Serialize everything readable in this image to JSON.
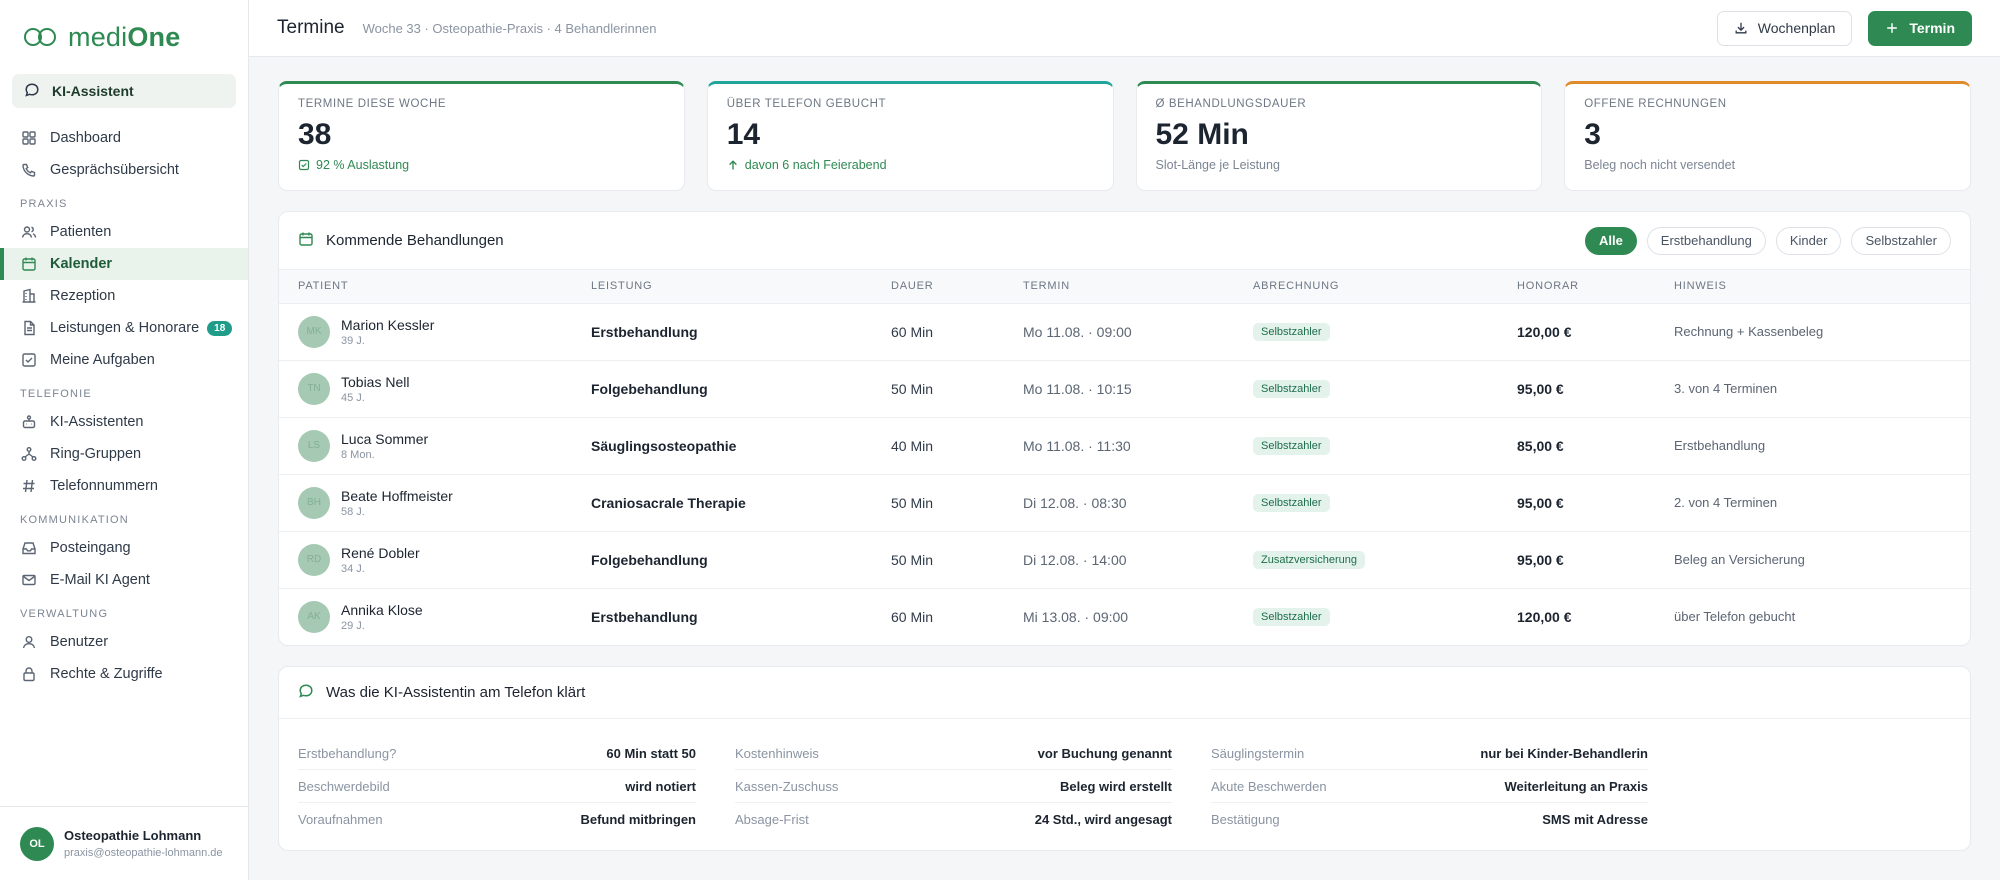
{
  "app": {
    "logo_light": "medi",
    "logo_bold": "One",
    "ki_button": "KI-Assistent"
  },
  "sidebar": {
    "top_items": [
      {
        "label": "Dashboard",
        "icon": "grid-icon"
      },
      {
        "label": "Gesprächsübersicht",
        "icon": "phone-icon"
      }
    ],
    "sections": [
      {
        "title": "PRAXIS",
        "items": [
          {
            "label": "Patienten",
            "icon": "users-icon"
          },
          {
            "label": "Kalender",
            "icon": "calendar-icon",
            "active": true
          },
          {
            "label": "Rezeption",
            "icon": "building-icon"
          },
          {
            "label": "Leistungen & Honorare",
            "icon": "document-icon",
            "badge": "18"
          },
          {
            "label": "Meine Aufgaben",
            "icon": "checkbox-icon"
          }
        ]
      },
      {
        "title": "TELEFONIE",
        "items": [
          {
            "label": "KI-Assistenten",
            "icon": "robot-icon"
          },
          {
            "label": "Ring-Gruppen",
            "icon": "network-icon"
          },
          {
            "label": "Telefonnummern",
            "icon": "hash-icon"
          }
        ]
      },
      {
        "title": "KOMMUNIKATION",
        "items": [
          {
            "label": "Posteingang",
            "icon": "inbox-icon"
          },
          {
            "label": "E-Mail KI Agent",
            "icon": "mail-icon"
          }
        ]
      },
      {
        "title": "VERWALTUNG",
        "items": [
          {
            "label": "Benutzer",
            "icon": "user-icon"
          },
          {
            "label": "Rechte & Zugriffe",
            "icon": "lock-icon"
          }
        ]
      }
    ],
    "user": {
      "initials": "OL",
      "name": "Osteopathie Lohmann",
      "email": "praxis@osteopathie-lohmann.de"
    }
  },
  "header": {
    "title": "Termine",
    "subtitle": "Woche 33 · Osteopathie-Praxis · 4 Behandlerinnen",
    "week_button": "Wochenplan",
    "add_button": "Termin"
  },
  "stats": [
    {
      "label": "TERMINE DIESE WOCHE",
      "value": "38",
      "foot": "92 % Auslastung",
      "color": "#2e8a52"
    },
    {
      "label": "ÜBER TELEFON GEBUCHT",
      "value": "14",
      "foot": "davon 6 nach Feierabend",
      "color": "#1fa59a"
    },
    {
      "label": "Ø BEHANDLUNGSDAUER",
      "value": "52 Min",
      "foot": "Slot-Länge je Leistung",
      "color": "#2e8a52"
    },
    {
      "label": "OFFENE RECHNUNGEN",
      "value": "3",
      "foot": "Beleg noch nicht versendet",
      "color": "#e08a2c"
    }
  ],
  "upcoming": {
    "title": "Kommende Behandlungen",
    "filters": [
      "Alle",
      "Erstbehandlung",
      "Kinder",
      "Selbstzahler"
    ],
    "columns": [
      "PATIENT",
      "LEISTUNG",
      "DAUER",
      "TERMIN",
      "ABRECHNUNG",
      "HONORAR",
      "HINWEIS"
    ],
    "rows": [
      {
        "initials": "MK",
        "name": "Marion Kessler",
        "age": "39 J.",
        "service": "Erstbehandlung",
        "duration": "60 Min",
        "date": "Mo 11.08. · 09:00",
        "billing": "Selbstzahler",
        "fee": "120,00 €",
        "note": "Rechnung + Kassenbeleg"
      },
      {
        "initials": "TN",
        "name": "Tobias Nell",
        "age": "45 J.",
        "service": "Folgebehandlung",
        "duration": "50 Min",
        "date": "Mo 11.08. · 10:15",
        "billing": "Selbstzahler",
        "fee": "95,00 €",
        "note": "3. von 4 Terminen"
      },
      {
        "initials": "LS",
        "name": "Luca Sommer",
        "age": "8 Mon.",
        "service": "Säuglingsosteopathie",
        "duration": "40 Min",
        "date": "Mo 11.08. · 11:30",
        "billing": "Selbstzahler",
        "fee": "85,00 €",
        "note": "Erstbehandlung"
      },
      {
        "initials": "BH",
        "name": "Beate Hoffmeister",
        "age": "58 J.",
        "service": "Craniosacrale Therapie",
        "duration": "50 Min",
        "date": "Di 12.08. · 08:30",
        "billing": "Selbstzahler",
        "fee": "95,00 €",
        "note": "2. von 4 Terminen"
      },
      {
        "initials": "RD",
        "name": "René Dobler",
        "age": "34 J.",
        "service": "Folgebehandlung",
        "duration": "50 Min",
        "date": "Di 12.08. · 14:00",
        "billing": "Zusatzversicherung",
        "fee": "95,00 €",
        "note": "Beleg an Versicherung"
      },
      {
        "initials": "AK",
        "name": "Annika Klose",
        "age": "29 J.",
        "service": "Erstbehandlung",
        "duration": "60 Min",
        "date": "Mi 13.08. · 09:00",
        "billing": "Selbstzahler",
        "fee": "120,00 €",
        "note": "über Telefon gebucht"
      }
    ]
  },
  "ki_card": {
    "title": "Was die KI-Assistentin am Telefon klärt",
    "columns": [
      [
        {
          "k": "Erstbehandlung?",
          "v": "60 Min statt 50"
        },
        {
          "k": "Beschwerdebild",
          "v": "wird notiert"
        },
        {
          "k": "Voraufnahmen",
          "v": "Befund mitbringen"
        }
      ],
      [
        {
          "k": "Kostenhinweis",
          "v": "vor Buchung genannt"
        },
        {
          "k": "Kassen-Zuschuss",
          "v": "Beleg wird erstellt"
        },
        {
          "k": "Absage-Frist",
          "v": "24 Std., wird angesagt"
        }
      ],
      [
        {
          "k": "Säuglingstermin",
          "v": "nur bei Kinder-Behandlerin"
        },
        {
          "k": "Akute Beschwerden",
          "v": "Weiterleitung an Praxis"
        },
        {
          "k": "Bestätigung",
          "v": "SMS mit Adresse"
        }
      ]
    ]
  }
}
